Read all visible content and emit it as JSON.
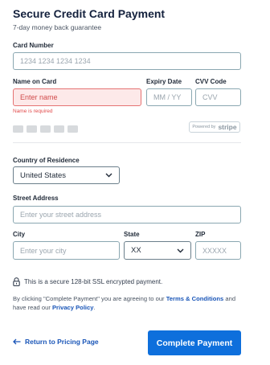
{
  "header": {
    "title": "Secure Credit Card Payment",
    "subtitle": "7-day money back guarantee"
  },
  "card_number": {
    "label": "Card Number",
    "placeholder": "1234 1234 1234 1234"
  },
  "name_on_card": {
    "label": "Name on Card",
    "placeholder": "Enter name",
    "error": "Name is required"
  },
  "expiry": {
    "label": "Expiry Date",
    "placeholder": "MM / YY"
  },
  "cvv": {
    "label": "CVV Code",
    "placeholder": "CVV"
  },
  "card_brands": [
    "visa-icon",
    "mastercard-icon",
    "amex-icon",
    "discover-icon",
    "card-icon"
  ],
  "stripe_badge": {
    "prefix": "Powered by",
    "brand": "stripe"
  },
  "country": {
    "label": "Country of Residence",
    "value": "United States"
  },
  "street": {
    "label": "Street Address",
    "placeholder": "Enter your street address"
  },
  "city": {
    "label": "City",
    "placeholder": "Enter your city"
  },
  "state": {
    "label": "State",
    "value": "XX"
  },
  "zip": {
    "label": "ZIP",
    "placeholder": "XXXXX"
  },
  "security_note": "This is a secure 128-bit SSL encrypted payment.",
  "agreement": {
    "text_before": "By clicking \"Complete Payment\" you are agreeing to our ",
    "terms_link": "Terms & Conditions",
    "text_middle": " and have read our ",
    "privacy_link": "Privacy Policy",
    "text_after": "."
  },
  "footer": {
    "back_label": "Return to Pricing Page",
    "submit_label": "Complete Payment"
  },
  "colors": {
    "accent": "#0e6fdc",
    "link": "#1a56b8",
    "error": "#e24b4b",
    "error_bg": "#fde9e9"
  }
}
